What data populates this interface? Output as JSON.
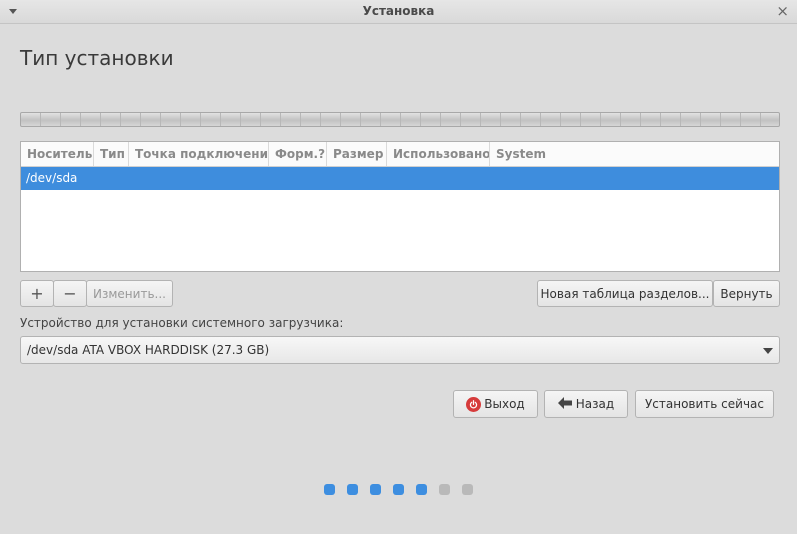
{
  "window": {
    "title": "Установка"
  },
  "page": {
    "title": "Тип установки"
  },
  "table": {
    "columns": [
      "Носитель",
      "Тип",
      "Точка подключения",
      "Форм.?",
      "Размер",
      "Использовано",
      "System"
    ],
    "rows": [
      {
        "device": "/dev/sda",
        "selected": true
      }
    ]
  },
  "partition_toolbar": {
    "add_label": "+",
    "remove_label": "−",
    "change_label": "Изменить...",
    "new_table_label": "Новая таблица разделов...",
    "revert_label": "Вернуть"
  },
  "bootloader": {
    "label": "Устройство для установки системного загрузчика:",
    "selected": "/dev/sda ATA VBOX HARDDISK (27.3 GB)"
  },
  "actions": {
    "quit_label": "Выход",
    "back_label": "Назад",
    "install_label": "Установить сейчас"
  },
  "progress": {
    "total_steps": 7,
    "completed_steps": 5,
    "active_color": "#3d8ee0",
    "inactive_color": "#b9b9b9"
  },
  "icons": {
    "window_menu": "chevron-down-icon",
    "close": "close-icon",
    "quit": "power-icon",
    "back": "arrow-left-icon",
    "dropdown": "chevron-down-icon"
  }
}
